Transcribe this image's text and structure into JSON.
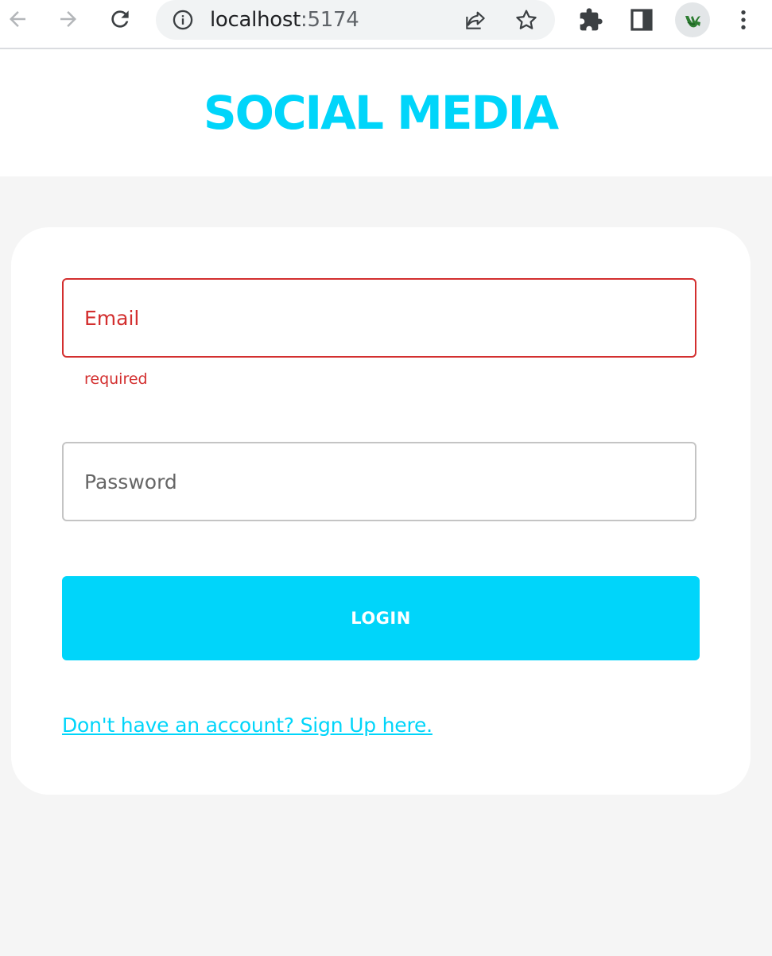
{
  "browser": {
    "url_host": "localhost",
    "url_port": ":5174",
    "icons": {
      "back": "back-arrow-icon",
      "forward": "forward-arrow-icon",
      "reload": "reload-icon",
      "site_info": "info-icon",
      "share": "share-icon",
      "bookmark": "star-icon",
      "extensions": "puzzle-icon",
      "side_panel": "side-panel-icon",
      "profile": "avatar",
      "menu": "kebab-menu-icon"
    }
  },
  "header": {
    "title": "SOCIAL MEDIA"
  },
  "form": {
    "email": {
      "placeholder": "Email",
      "value": "",
      "helper": "required"
    },
    "password": {
      "placeholder": "Password",
      "value": ""
    },
    "login_label": "LOGIN",
    "signup_link": "Don't have an account? Sign Up here."
  },
  "colors": {
    "accent": "#00d5fa",
    "error": "#d32f2f",
    "background": "#f5f5f5"
  }
}
